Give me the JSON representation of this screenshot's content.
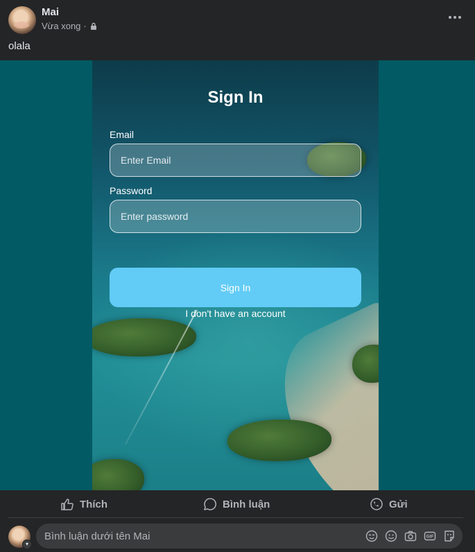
{
  "post": {
    "author": "Mai",
    "timestamp": "Vừa xong",
    "separator": "·",
    "privacy_icon": "lock-icon",
    "text": "olala",
    "more_icon": "more-horizontal-icon"
  },
  "signin": {
    "title": "Sign In",
    "email_label": "Email",
    "email_placeholder": "Enter Email",
    "password_label": "Password",
    "password_placeholder": "Enter password",
    "button_label": "Sign In",
    "no_account": "I don't have an account",
    "button_color": "#62ccf6"
  },
  "actions": {
    "like": "Thích",
    "comment": "Bình luận",
    "share": "Gửi"
  },
  "comment": {
    "placeholder": "Bình luận dưới tên Mai",
    "tools": [
      "sticker-icon",
      "emoji-icon",
      "camera-icon",
      "gif-icon",
      "avatar-sticker-icon"
    ]
  },
  "colors": {
    "background": "#242526",
    "media_bg": "#025a64",
    "text_primary": "#e4e6eb",
    "text_secondary": "#b0b3b8"
  }
}
